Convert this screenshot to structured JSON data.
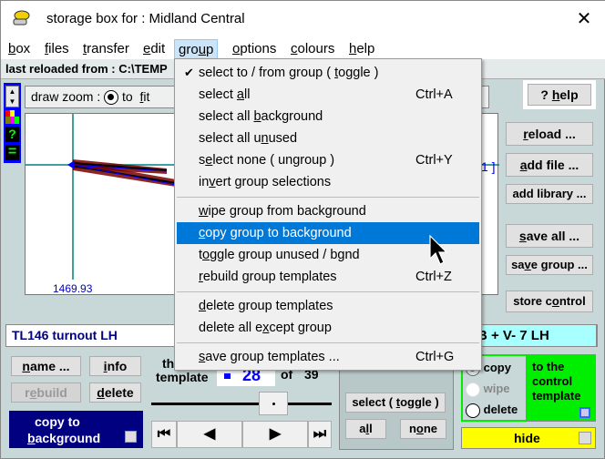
{
  "window": {
    "title": "storage  box  for :   Midland Central",
    "close_label": "✕"
  },
  "menubar": {
    "items": [
      {
        "label": "box",
        "ul": "b",
        "rest": "ox"
      },
      {
        "label": "files",
        "ul": "f",
        "rest": "iles"
      },
      {
        "label": "transfer",
        "ul": "t",
        "rest": "ransfer"
      },
      {
        "label": "edit",
        "ul": "e",
        "rest": "dit"
      },
      {
        "label": "group",
        "pre": "gro",
        "ul": "u",
        "rest": "p"
      },
      {
        "label": "options",
        "ul": "o",
        "rest": "ptions"
      },
      {
        "label": "colours",
        "ul": "c",
        "rest": "olours"
      },
      {
        "label": "help",
        "ul": "h",
        "rest": "elp"
      }
    ]
  },
  "status": {
    "last_reloaded": "last reloaded from :  C:\\TEMP"
  },
  "toolstrip": {
    "scroll_up": "▲",
    "scroll_down": "▼",
    "help": "?",
    "equals": "="
  },
  "zoombar": {
    "label": "draw zoom :",
    "to": "to",
    "fit_ul": "f",
    "fit_rest": "it"
  },
  "canvas": {
    "x_label": "1469.93",
    "partial_text": "1 ]"
  },
  "dropdown": {
    "items": [
      {
        "pre": "select  to / from  group  ( ",
        "ul": "t",
        "post": "oggle )",
        "shortcut": "",
        "checked": true
      },
      {
        "pre": "select  ",
        "ul": "a",
        "post": "ll",
        "shortcut": "Ctrl+A"
      },
      {
        "pre": "select  all  ",
        "ul": "b",
        "post": "ackground",
        "shortcut": ""
      },
      {
        "pre": "select  all  u",
        "ul": "n",
        "post": "used",
        "shortcut": ""
      },
      {
        "pre": "s",
        "ul": "e",
        "post": "lect  none  ( ungroup )",
        "shortcut": "Ctrl+Y"
      },
      {
        "pre": "in",
        "ul": "v",
        "post": "ert  group  selections",
        "shortcut": ""
      },
      {
        "pre": "",
        "ul": "w",
        "post": "ipe  group  from  background",
        "shortcut": ""
      },
      {
        "pre": "",
        "ul": "c",
        "post": "opy  group  to  background",
        "shortcut": "",
        "highlighted": true
      },
      {
        "pre": "t",
        "ul": "o",
        "post": "ggle  group  unused / bgnd",
        "shortcut": ""
      },
      {
        "pre": "",
        "ul": "r",
        "post": "ebuild  group  templates",
        "shortcut": "Ctrl+Z"
      },
      {
        "pre": "",
        "ul": "d",
        "post": "elete  group  templates",
        "shortcut": ""
      },
      {
        "pre": "delete  all  e",
        "ul": "x",
        "post": "cept  group",
        "shortcut": ""
      },
      {
        "pre": "",
        "ul": "s",
        "post": "ave  group  templates ...",
        "shortcut": "Ctrl+G"
      }
    ]
  },
  "right_panel": {
    "help": {
      "pre": "? ",
      "ul": "h",
      "post": "elp"
    },
    "reload": {
      "pre": "",
      "ul": "r",
      "post": "eload ..."
    },
    "add_file": {
      "pre": "",
      "ul": "a",
      "post": "dd  file ..."
    },
    "add_library": "add library ...",
    "save_all": {
      "pre": "",
      "ul": "s",
      "post": "ave  all ..."
    },
    "save_group": {
      "pre": "sa",
      "ul": "v",
      "post": "e group ..."
    },
    "store_control": {
      "pre": "store c",
      "ul": "o",
      "post": "ntrol"
    }
  },
  "infobar": {
    "left_text": "TL146   turnout  LH",
    "right_text": "B  +  V- 7   LH"
  },
  "bottom": {
    "name_btn": {
      "pre": "",
      "ul": "n",
      "post": "ame ..."
    },
    "info_btn": {
      "pre": "",
      "ul": "i",
      "post": "nfo"
    },
    "rebuild_btn": {
      "pre": "r",
      "ul": "e",
      "post": "build"
    },
    "delete_btn": {
      "pre": "",
      "ul": "d",
      "post": "elete"
    },
    "copy_to_bg_line1": "copy  to",
    "copy_to_bg_ul": "b",
    "copy_to_bg_rest": "ackground",
    "template_label_1": "th",
    "template_label_2": "template",
    "template_number": "28",
    "template_of": "of",
    "template_total": "39",
    "nav_first": "⏮",
    "nav_prev": "◀",
    "nav_next": "▶",
    "nav_last": "⏭",
    "select_toggle": {
      "pre": "select  ( ",
      "ul": "t",
      "post": "oggle )"
    },
    "all_btn": {
      "pre": "a",
      "ul": "l",
      "post": "l"
    },
    "none_btn": {
      "pre": "n",
      "ul": "o",
      "post": "ne"
    },
    "radio_copy": "copy",
    "radio_wipe": "wipe",
    "radio_delete": "delete",
    "control_template_text": "to the control template",
    "hide_label": "hide"
  }
}
